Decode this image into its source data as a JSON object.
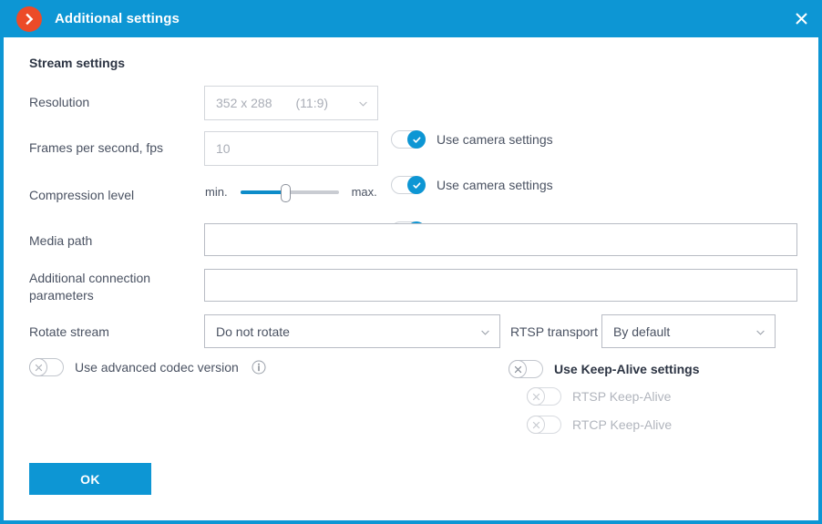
{
  "window": {
    "title": "Additional settings",
    "app_icon": "chevron-right-circle-icon",
    "close_icon": "close-icon",
    "accent_color": "#0d96d4",
    "icon_color": "#ec4b28"
  },
  "section": {
    "title": "Stream settings"
  },
  "rows": {
    "resolution": {
      "label": "Resolution",
      "value": "352 x 288",
      "value_sub": "(11:9)",
      "disabled": true,
      "toggle_label": "Use camera settings",
      "toggle_state": "on"
    },
    "fps": {
      "label": "Frames per second, fps",
      "value": "10",
      "disabled": true,
      "toggle_label": "Use camera settings",
      "toggle_state": "on"
    },
    "compression": {
      "label": "Compression level",
      "min_label": "min.",
      "max_label": "max.",
      "slider_percent": 45,
      "toggle_label": "Use camera settings",
      "toggle_state": "on"
    },
    "media_path": {
      "label": "Media path",
      "value": "",
      "placeholder": ""
    },
    "additional_params": {
      "label": "Additional connection parameters",
      "label_line1": "Additional connection",
      "label_line2": "parameters",
      "value": "",
      "placeholder": ""
    },
    "rotate_stream": {
      "label": "Rotate stream",
      "value": "Do not rotate"
    },
    "rtsp_transport": {
      "label": "RTSP transport",
      "value": "By default"
    }
  },
  "toggles": {
    "advanced_codec": {
      "label": "Use advanced codec version",
      "state": "off",
      "info_icon": "info-icon"
    },
    "keep_alive": {
      "label": "Use Keep-Alive settings",
      "state": "off"
    },
    "rtsp_keep_alive": {
      "label": "RTSP Keep-Alive",
      "state": "off",
      "disabled": true
    },
    "rtcp_keep_alive": {
      "label": "RTCP Keep-Alive",
      "state": "off",
      "disabled": true
    }
  },
  "buttons": {
    "ok": "OK"
  }
}
